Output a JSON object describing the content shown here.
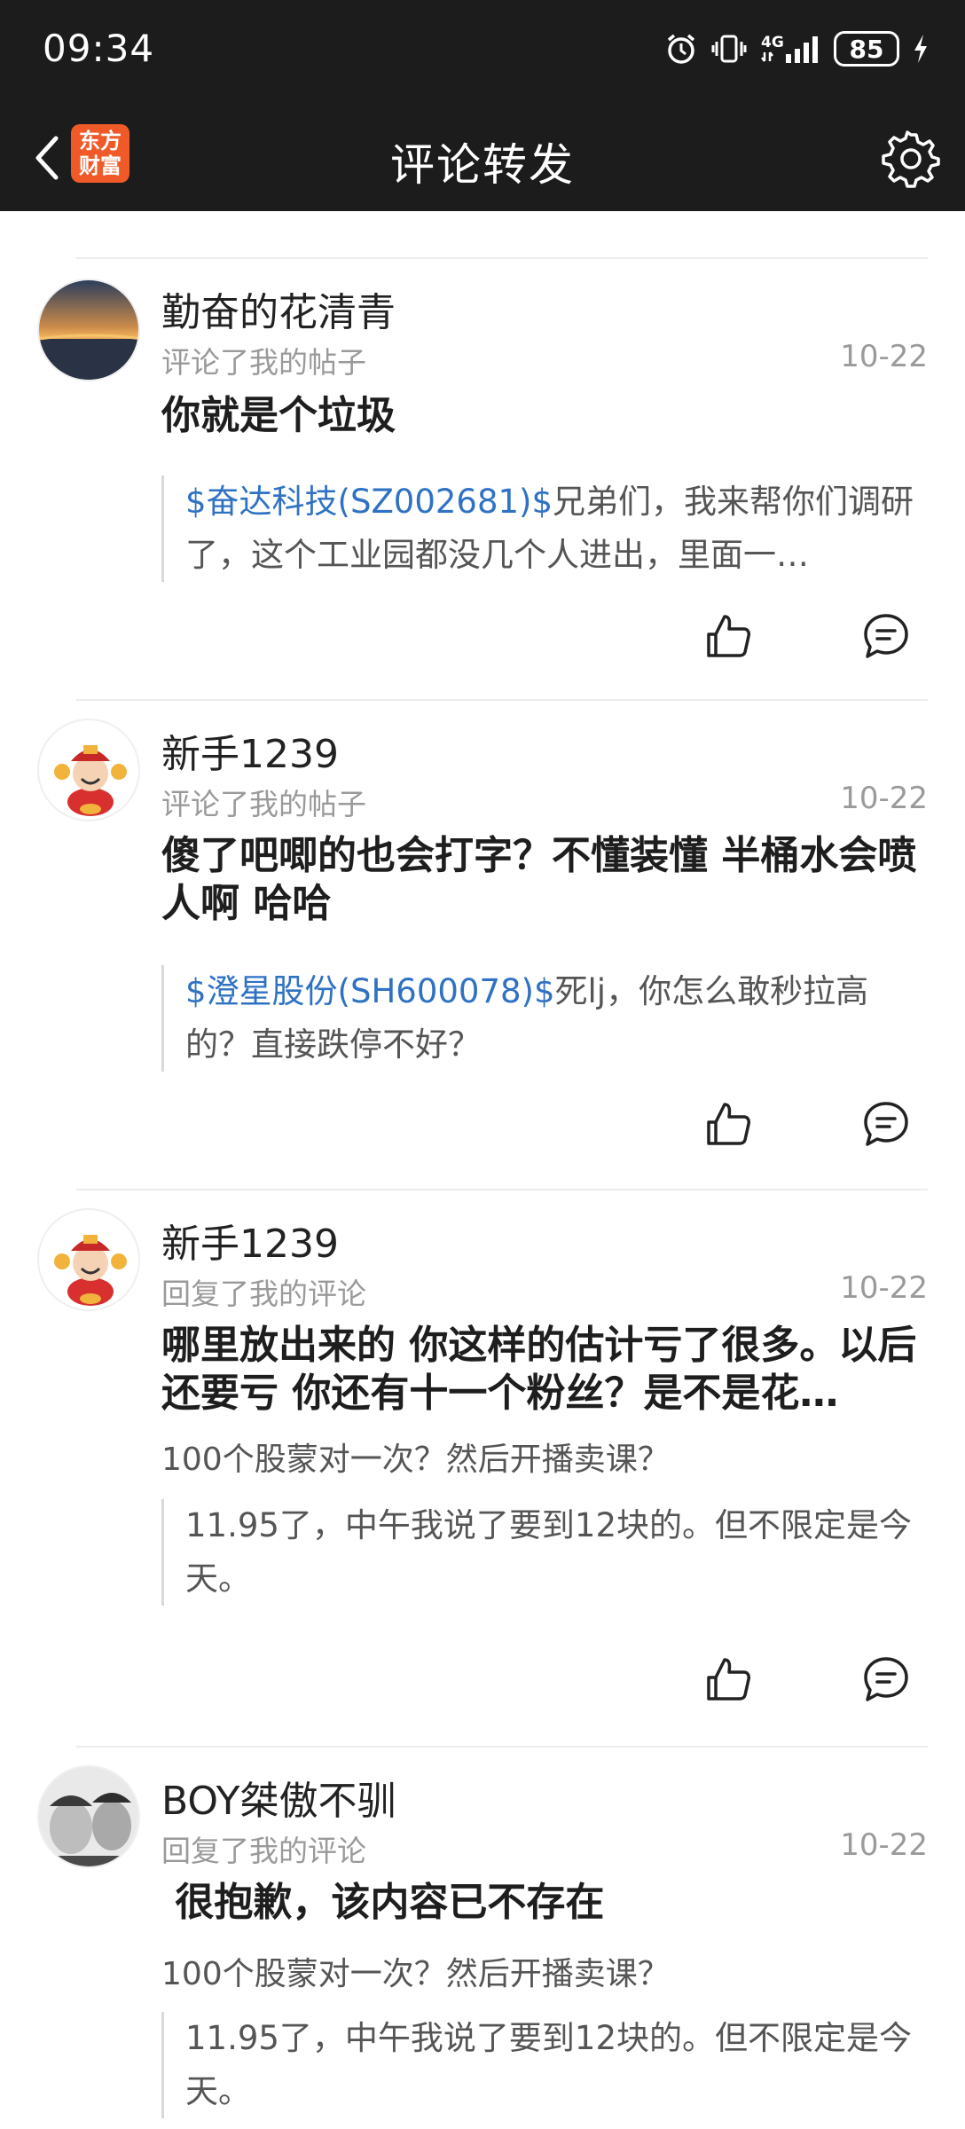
{
  "status_bar": {
    "time": "09:34",
    "network": "4G",
    "battery": "85",
    "icons": [
      "alarm-icon",
      "vibrate-icon",
      "signal-icon",
      "battery-icon",
      "charging-icon"
    ]
  },
  "nav": {
    "title": "评论转发",
    "logo_line1": "东方",
    "logo_line2": "财富",
    "back_icon": "back-arrow-icon",
    "settings_icon": "gear-icon"
  },
  "colors": {
    "bar_bg": "#1c1c1c",
    "logo_bg": "#f05a28",
    "stock_link": "#2f72c3",
    "meta_gray": "#9a9a9a"
  },
  "cards": [
    {
      "username": "勤奋的花清青",
      "action": "评论了我的帖子",
      "date": "10-22",
      "comment": "你就是个垃圾",
      "quote_stock": "$奋达科技(SZ002681)$",
      "quote_text": "兄弟们，我来帮你们调研了，这个工业园都没几个人进出，里面一…"
    },
    {
      "username": "新手1239",
      "action": "评论了我的帖子",
      "date": "10-22",
      "comment": "傻了吧唧的也会打字？不懂装懂 半桶水会喷人啊 哈哈",
      "quote_stock": "$澄星股份(SH600078)$",
      "quote_text": "死lj，你怎么敢秒拉高的？直接跌停不好？"
    },
    {
      "username": "新手1239",
      "action": "回复了我的评论",
      "date": "10-22",
      "comment": "哪里放出来的 你这样的估计亏了很多。以后还要亏 你还有十一个粉丝？是不是花…",
      "reply": "100个股蒙对一次？然后开播卖课？",
      "quote_text": "11.95了，中午我说了要到12块的。但不限定是今天。"
    },
    {
      "username": "BOY桀傲不驯",
      "action": "回复了我的评论",
      "date": "10-22",
      "comment": " 很抱歉，该内容已不存在",
      "reply": "100个股蒙对一次？然后开播卖课？",
      "quote_text": "11.95了，中午我说了要到12块的。但不限定是今天。"
    }
  ]
}
